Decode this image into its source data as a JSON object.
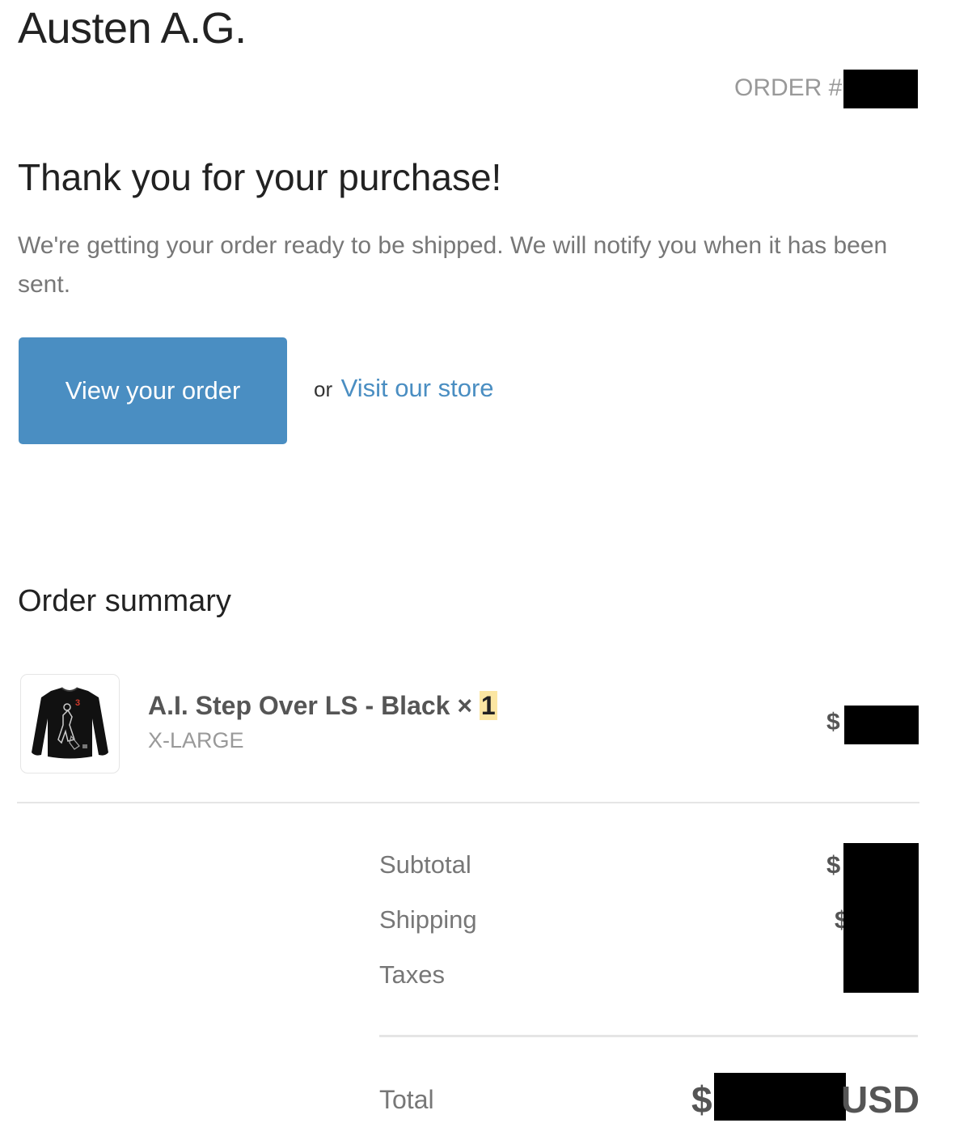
{
  "header": {
    "shop_name": "Austen A.G.",
    "order_label": "ORDER #"
  },
  "confirmation": {
    "title": "Thank you for your purchase!",
    "message": "We're getting your order ready to be shipped. We will notify you when it has been sent.",
    "view_order_label": "View your order",
    "or_text": "or",
    "visit_store_label": "Visit our store"
  },
  "summary": {
    "title": "Order summary",
    "item": {
      "name": "A.I. Step Over LS - Black ×",
      "quantity": "1",
      "variant": "X-LARGE",
      "price_prefix": "$",
      "image_icon": "tshirt-icon",
      "shirt_number": "3"
    },
    "lines": [
      {
        "label": "Subtotal",
        "value_prefix": "$"
      },
      {
        "label": "Shipping",
        "value_prefix": "$"
      },
      {
        "label": "Taxes",
        "value_prefix": ""
      }
    ],
    "total": {
      "label": "Total",
      "value_prefix": "$",
      "currency": "USD"
    }
  },
  "colors": {
    "accent": "#4a8ec2",
    "redaction": "#000000",
    "highlight": "#fbe6a2"
  }
}
